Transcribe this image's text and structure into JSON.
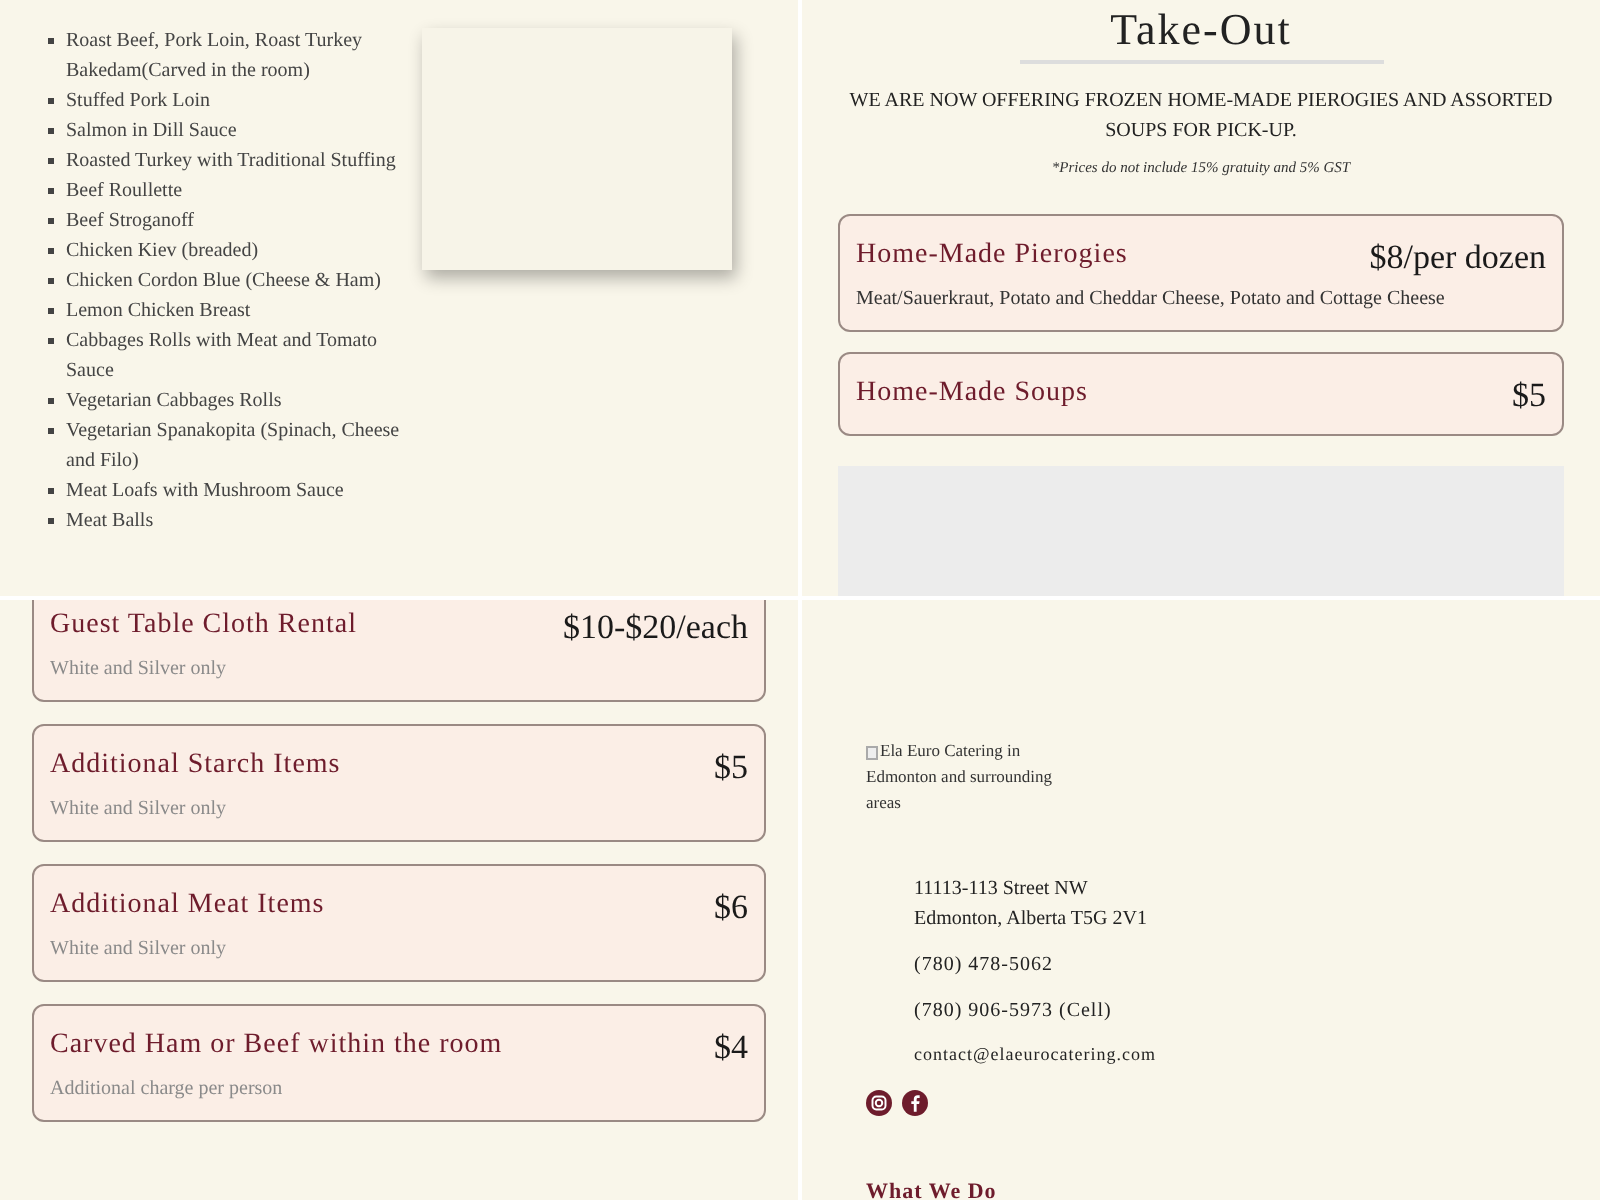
{
  "menu_items": [
    "Roast Beef, Pork Loin, Roast Turkey Bakedam(Carved in the room)",
    "Stuffed Pork Loin",
    "Salmon in Dill Sauce",
    "Roasted Turkey with Traditional Stuffing",
    "Beef Roullette",
    "Beef Stroganoff",
    "Chicken Kiev (breaded)",
    "Chicken Cordon Blue (Cheese & Ham)",
    "Lemon Chicken Breast",
    "Cabbages Rolls with Meat and Tomato Sauce",
    "Vegetarian Cabbages Rolls",
    "Vegetarian Spanakopita (Spinach, Cheese and Filo)",
    "Meat Loafs with Mushroom Sauce",
    "Meat Balls"
  ],
  "take_out": {
    "title": "Take-Out",
    "intro": "WE ARE NOW OFFERING FROZEN HOME-MADE PIEROGIES AND ASSORTED SOUPS FOR PICK-UP.",
    "note": "*Prices do not include 15% gratuity and 5% GST",
    "items": [
      {
        "name": "Home-Made Pierogies",
        "price": "$8/per dozen",
        "description": "Meat/Sauerkraut, Potato and Cheddar Cheese, Potato and Cottage Cheese"
      },
      {
        "name": "Home-Made Soups",
        "price": "$5"
      }
    ]
  },
  "extras": [
    {
      "name": "Guest Table Cloth Rental",
      "price": "$10-$20/each",
      "description": "White and Silver only"
    },
    {
      "name": "Additional Starch Items",
      "price": "$5",
      "description": "White and Silver only"
    },
    {
      "name": "Additional Meat Items",
      "price": "$6",
      "description": "White and Silver only"
    },
    {
      "name": "Carved Ham or Beef within the room",
      "price": "$4",
      "description": "Additional charge per person"
    }
  ],
  "footer": {
    "logo_alt": "Ela Euro Catering in Edmonton and surrounding areas",
    "address": [
      "11113-113 Street NW",
      "Edmonton, Alberta T5G 2V1"
    ],
    "phone": "(780) 478-5062",
    "cell": "(780) 906-5973 (Cell)",
    "email": "contact@elaeurocatering.com",
    "heading": "What We Do"
  }
}
